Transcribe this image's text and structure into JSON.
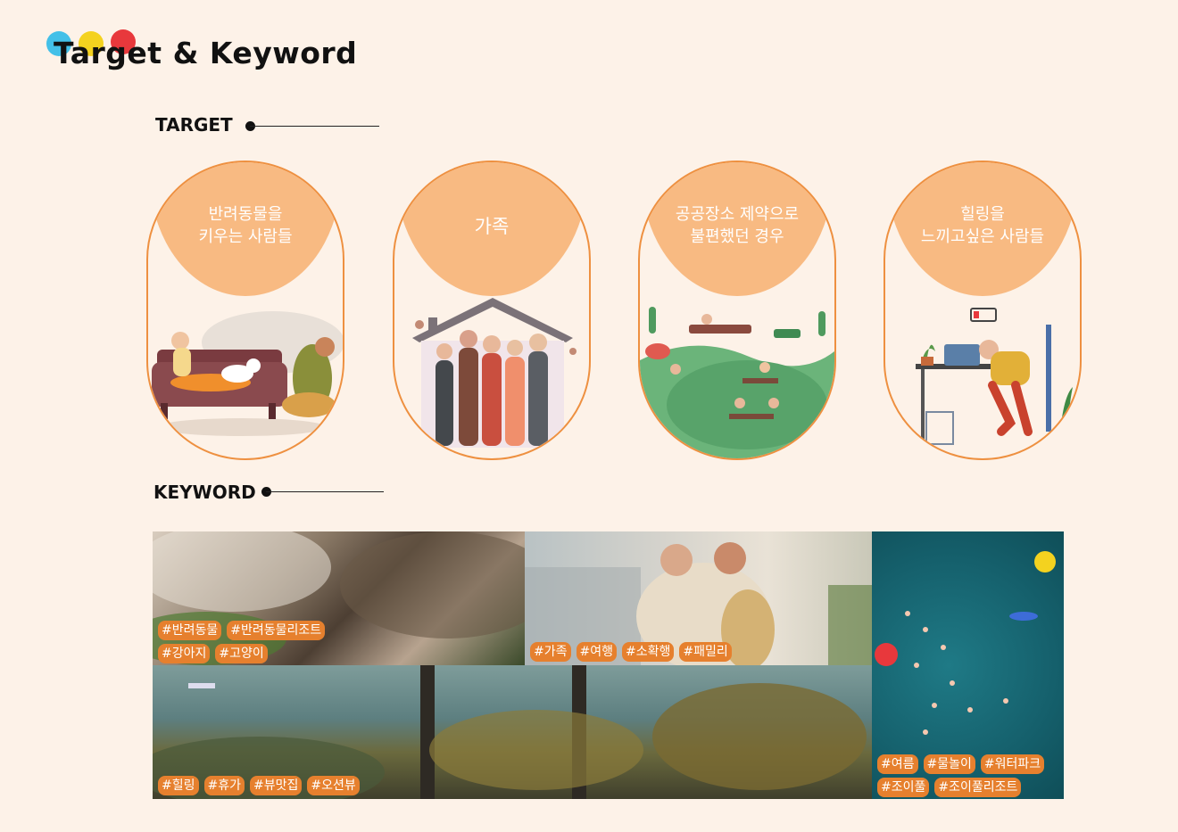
{
  "header": {
    "title": "Target & Keyword"
  },
  "sections": {
    "target_label": "TARGET",
    "keyword_label": "KEYWORD"
  },
  "colors": {
    "accent": "#e6802e",
    "pill_fill": "#f8ba82",
    "background": "#fdf2e8",
    "dot_blue": "#43c0e8",
    "dot_yellow": "#f4d21f",
    "dot_red": "#e8383c"
  },
  "targets": [
    {
      "lines": [
        "반려동물을",
        "키우는 사람들"
      ],
      "icon": "pet-owner-illustration"
    },
    {
      "lines": [
        "가족"
      ],
      "icon": "family-illustration"
    },
    {
      "lines": [
        "공공장소 제약으로",
        "불편했던 경우"
      ],
      "icon": "public-park-illustration"
    },
    {
      "lines": [
        "힐링을",
        "느끼고싶은 사람들"
      ],
      "icon": "tired-worker-illustration"
    }
  ],
  "keywords": {
    "pets": [
      "#반려동물",
      "#반려동물리조트",
      "#강아지",
      "#고양이"
    ],
    "family": [
      "#가족",
      "#여행",
      "#소확행",
      "#패밀리"
    ],
    "healing": [
      "#힐링",
      "#휴가",
      "#뷰맛집",
      "#오션뷰"
    ],
    "summer": [
      "#여름",
      "#물놀이",
      "#워터파크",
      "#조이풀",
      "#조이풀리조트"
    ]
  }
}
